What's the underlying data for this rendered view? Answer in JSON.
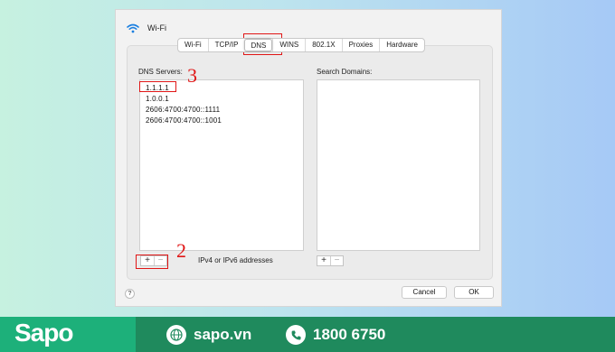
{
  "window": {
    "title": "Wi-Fi"
  },
  "tabs": [
    {
      "label": "Wi-Fi",
      "selected": false
    },
    {
      "label": "TCP/IP",
      "selected": false
    },
    {
      "label": "DNS",
      "selected": true
    },
    {
      "label": "WINS",
      "selected": false
    },
    {
      "label": "802.1X",
      "selected": false
    },
    {
      "label": "Proxies",
      "selected": false
    },
    {
      "label": "Hardware",
      "selected": false
    }
  ],
  "dns": {
    "label": "DNS Servers:",
    "entries": [
      "1.1.1.1",
      "1.0.0.1",
      "2606:4700:4700::1111",
      "2606:4700:4700::1001"
    ],
    "hint": "IPv4 or IPv6 addresses"
  },
  "search": {
    "label": "Search Domains:"
  },
  "controls": {
    "add": "+",
    "remove": "−"
  },
  "buttons": {
    "help": "?",
    "cancel": "Cancel",
    "ok": "OK"
  },
  "annotations": {
    "one": "1",
    "two": "2",
    "three": "3"
  },
  "footer": {
    "brand": "Sapo",
    "website": "sapo.vn",
    "phone": "1800 6750"
  },
  "colors": {
    "annotation": "#e01616",
    "brand_green": "#1db07a",
    "footer_dark": "#1f8a5d"
  }
}
